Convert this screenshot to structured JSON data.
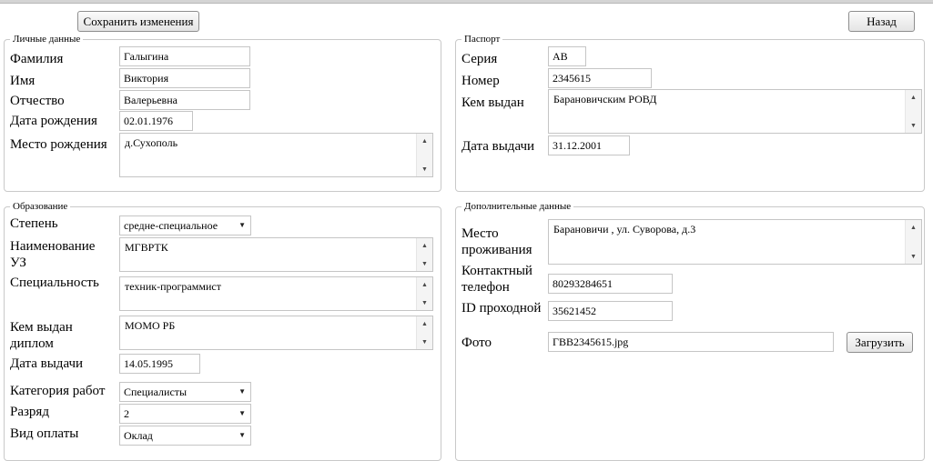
{
  "toolbar": {
    "save_label": "Сохранить изменения",
    "back_label": "Назад"
  },
  "personal": {
    "legend": "Личные данные",
    "surname_label": "Фамилия",
    "surname_value": "Галыгина",
    "name_label": "Имя",
    "name_value": "Виктория",
    "patronymic_label": "Отчество",
    "patronymic_value": "Валерьевна",
    "birthdate_label": "Дата рождения",
    "birthdate_value": "02.01.1976",
    "birthplace_label": "Место рождения",
    "birthplace_value": "д.Сухополь"
  },
  "passport": {
    "legend": "Паспорт",
    "series_label": "Серия",
    "series_value": "АВ",
    "number_label": "Номер",
    "number_value": "2345615",
    "issued_by_label": "Кем выдан",
    "issued_by_value": "Барановичским  РОВД",
    "issue_date_label": "Дата выдачи",
    "issue_date_value": "31.12.2001"
  },
  "education": {
    "legend": "Образование",
    "degree_label": "Степень",
    "degree_value": "средне-специальное",
    "institution_label": "Наименование УЗ",
    "institution_value": "МГВРТК",
    "specialty_label": "Специальность",
    "specialty_value": "техник-программист",
    "diploma_issuer_label": "Кем выдан диплом",
    "diploma_issuer_value": "МОМО РБ",
    "issue_date_label": "Дата выдачи",
    "issue_date_value": "14.05.1995",
    "work_category_label": "Категория работ",
    "work_category_value": "Специалисты",
    "grade_label": "Разряд",
    "grade_value": "2",
    "payment_label": "Вид оплаты",
    "payment_value": "Оклад"
  },
  "additional": {
    "legend": "Дополнительные данные",
    "residence_label": "Место проживания",
    "residence_value": "Барановичи , ул. Суворова, д.3",
    "phone_label": "Контактный телефон",
    "phone_value": "80293284651",
    "pass_id_label": "ID проходной",
    "pass_id_value": "35621452",
    "photo_label": "Фото",
    "photo_value": "ГВВ2345615.jpg",
    "upload_label": "Загрузить"
  },
  "icons": {
    "scroll_up": "scroll-up-arrow-icon",
    "scroll_down": "scroll-down-arrow-icon",
    "dropdown": "chevron-down-icon"
  }
}
